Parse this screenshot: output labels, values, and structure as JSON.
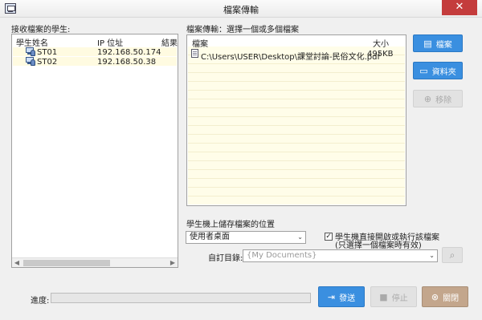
{
  "window": {
    "title": "檔案傳輸",
    "close_glyph": "✕"
  },
  "students": {
    "group_label": "接收檔案的學生:",
    "columns": [
      "學生姓名",
      "IP 位址",
      "結果"
    ],
    "rows": [
      {
        "name": "ST01",
        "ip": "192.168.50.174",
        "result": ""
      },
      {
        "name": "ST02",
        "ip": "192.168.50.38",
        "result": ""
      }
    ]
  },
  "transfer": {
    "group_label": "檔案傳輸：選擇一個或多個檔案",
    "columns": [
      "檔案",
      "大小"
    ],
    "files": [
      {
        "path": "C:\\Users\\USER\\Desktop\\課堂討論-民俗文化.pdf",
        "size": "495KB"
      }
    ]
  },
  "side_buttons": {
    "file": "檔案",
    "folder": "資料夾",
    "remove": "移除"
  },
  "save_location": {
    "group_label": "學生機上儲存檔案的位置",
    "selected": "使用者桌面",
    "checkbox_label_line1": "學生機直接開啟或執行該檔案",
    "checkbox_label_line2": "(只選擇一個檔案時有效)",
    "checkbox_checked": true,
    "custom_dir_label": "自訂目錄:",
    "custom_dir_value": "{My Documents}"
  },
  "footer": {
    "progress_label": "進度:",
    "progress": 0,
    "send": "發送",
    "stop": "停止",
    "close": "關閉"
  },
  "colors": {
    "accent_blue": "#3a8fe0",
    "close_tan": "#c3a68c",
    "row_highlight": "#fffbe1",
    "titlebar_close": "#c43c3c"
  }
}
